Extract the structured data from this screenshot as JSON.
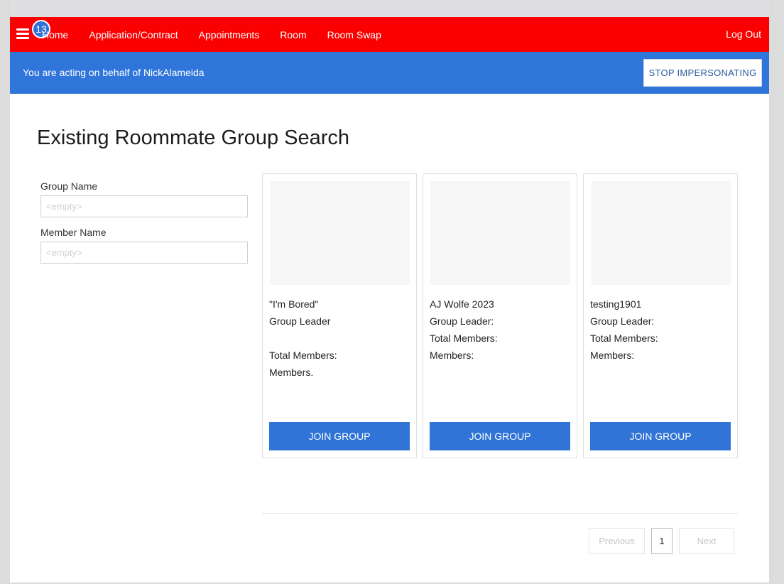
{
  "navbar": {
    "notification_count": "13",
    "links": [
      "Home",
      "Application/Contract",
      "Appointments",
      "Room",
      "Room Swap"
    ],
    "logout_label": "Log Out"
  },
  "impersonation": {
    "message": "You are acting on behalf of NickAlameida",
    "stop_label": "STOP IMPERSONATING"
  },
  "page": {
    "title": "Existing Roommate Group Search"
  },
  "filters": {
    "group_name_label": "Group Name",
    "group_name_placeholder": "<empty>",
    "member_name_label": "Member Name",
    "member_name_placeholder": "<empty>"
  },
  "groups": [
    {
      "name": "\"I'm Bored\"",
      "leader_label": "Group Leader",
      "total_label": "Total Members:",
      "members_label": "Members.",
      "join_label": "JOIN GROUP"
    },
    {
      "name": "AJ Wolfe 2023",
      "leader_label": "Group Leader:",
      "total_label": "Total Members:",
      "members_label": "Members:",
      "join_label": "JOIN GROUP"
    },
    {
      "name": "testing1901",
      "leader_label": "Group Leader:",
      "total_label": "Total Members:",
      "members_label": "Members:",
      "join_label": "JOIN GROUP"
    }
  ],
  "pagination": {
    "previous_label": "Previous",
    "current_page": "1",
    "next_label": "Next"
  },
  "colors": {
    "navbar": "#fa0000",
    "impersonation_bar": "#2f75da",
    "primary_button": "#2f74d6"
  }
}
